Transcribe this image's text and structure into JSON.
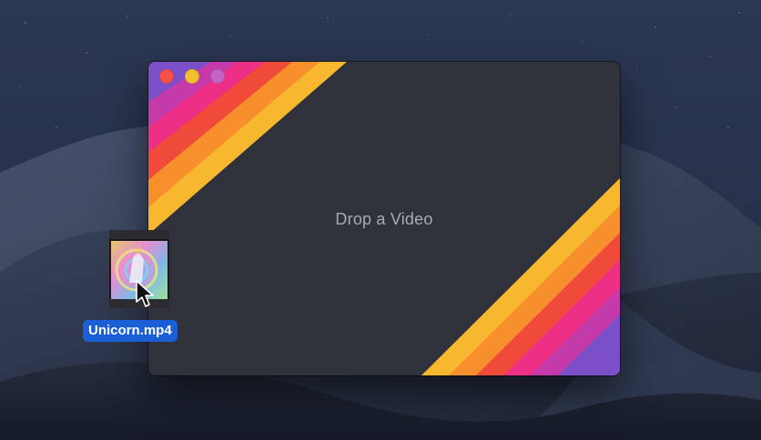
{
  "window": {
    "drop_prompt": "Drop a Video"
  },
  "file": {
    "name": "Unicorn.mp4",
    "icon": "video-file-thumbnail-icon"
  },
  "traffic_lights": [
    "close",
    "minimize",
    "zoom"
  ],
  "colors": {
    "window_bg": "#2f313b",
    "stripes": [
      "#7b4fc8",
      "#c43aa8",
      "#ee2f86",
      "#f04a3a",
      "#f7902c",
      "#f7b82f"
    ],
    "selection": "#1a5fd6",
    "close": "#f5524a",
    "minimize": "#f2c02f",
    "zoom": "#c465c2"
  }
}
